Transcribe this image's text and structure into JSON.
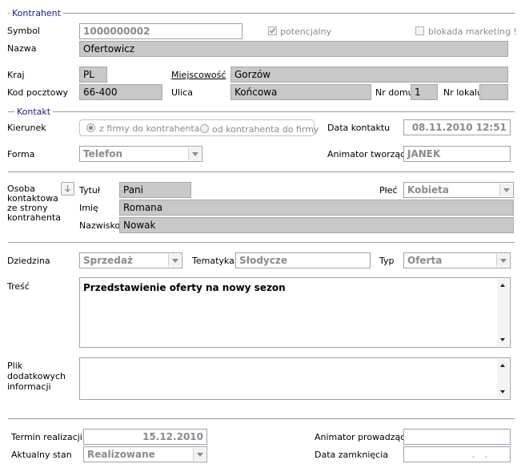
{
  "kontrahent": {
    "section_title": "Kontrahent",
    "symbol_label": "Symbol",
    "symbol_value": "1000000002",
    "potencjalny_label": "potencjalny",
    "blokada_label": "blokada marketing !",
    "nazwa_label": "Nazwa",
    "nazwa_value": "Ofertowicz",
    "kraj_label": "Kraj",
    "kraj_value": "PL",
    "miejscowosc_label": "Miejscowość",
    "miejscowosc_value": "Gorzów",
    "kod_label": "Kod pocztowy",
    "kod_value": "66-400",
    "ulica_label": "Ulica",
    "ulica_value": "Końcowa",
    "nrdomu_label": "Nr domu",
    "nrdomu_value": "1",
    "nrlokalu_label": "Nr lokalu",
    "nrlokalu_value": ""
  },
  "kontakt": {
    "section_title": "Kontakt",
    "kierunek_label": "Kierunek",
    "radio_1": "z firmy do kontrahenta",
    "radio_2": "od kontrahenta do firmy",
    "data_kontaktu_label": "Data kontaktu",
    "data_kontaktu_value": "08.11.2010 12:51",
    "forma_label": "Forma",
    "forma_value": "Telefon",
    "animator_label": "Animator tworzący",
    "animator_value": "JANEK"
  },
  "osoba": {
    "label": "Osoba kontaktowa ze strony kontrahenta",
    "tytul_label": "Tytuł",
    "tytul_value": "Pani",
    "plec_label": "Płeć",
    "plec_value": "Kobieta",
    "imie_label": "Imię",
    "imie_value": "Romana",
    "nazwisko_label": "Nazwisko",
    "nazwisko_value": "Nowak"
  },
  "tresc": {
    "dziedzina_label": "Dziedzina",
    "dziedzina_value": "Sprzedaż",
    "tematyka_label": "Tematyka",
    "tematyka_value": "Słodycze",
    "typ_label": "Typ",
    "typ_value": "Oferta",
    "tresc_label": "Treść",
    "tresc_value": "Przedstawienie oferty na nowy sezon",
    "plik_label": "Plik dodatkowych informacji",
    "plik_value": ""
  },
  "footer": {
    "termin_label": "Termin realizacji",
    "termin_value": "15.12.2010",
    "stan_label": "Aktualny stan",
    "stan_value": "Realizowane",
    "animator_prow_label": "Animator prowadzący",
    "animator_prow_value": "",
    "data_zamkniecia_label": "Data zamknięcia",
    "data_zamkniecia_value": ". ."
  }
}
